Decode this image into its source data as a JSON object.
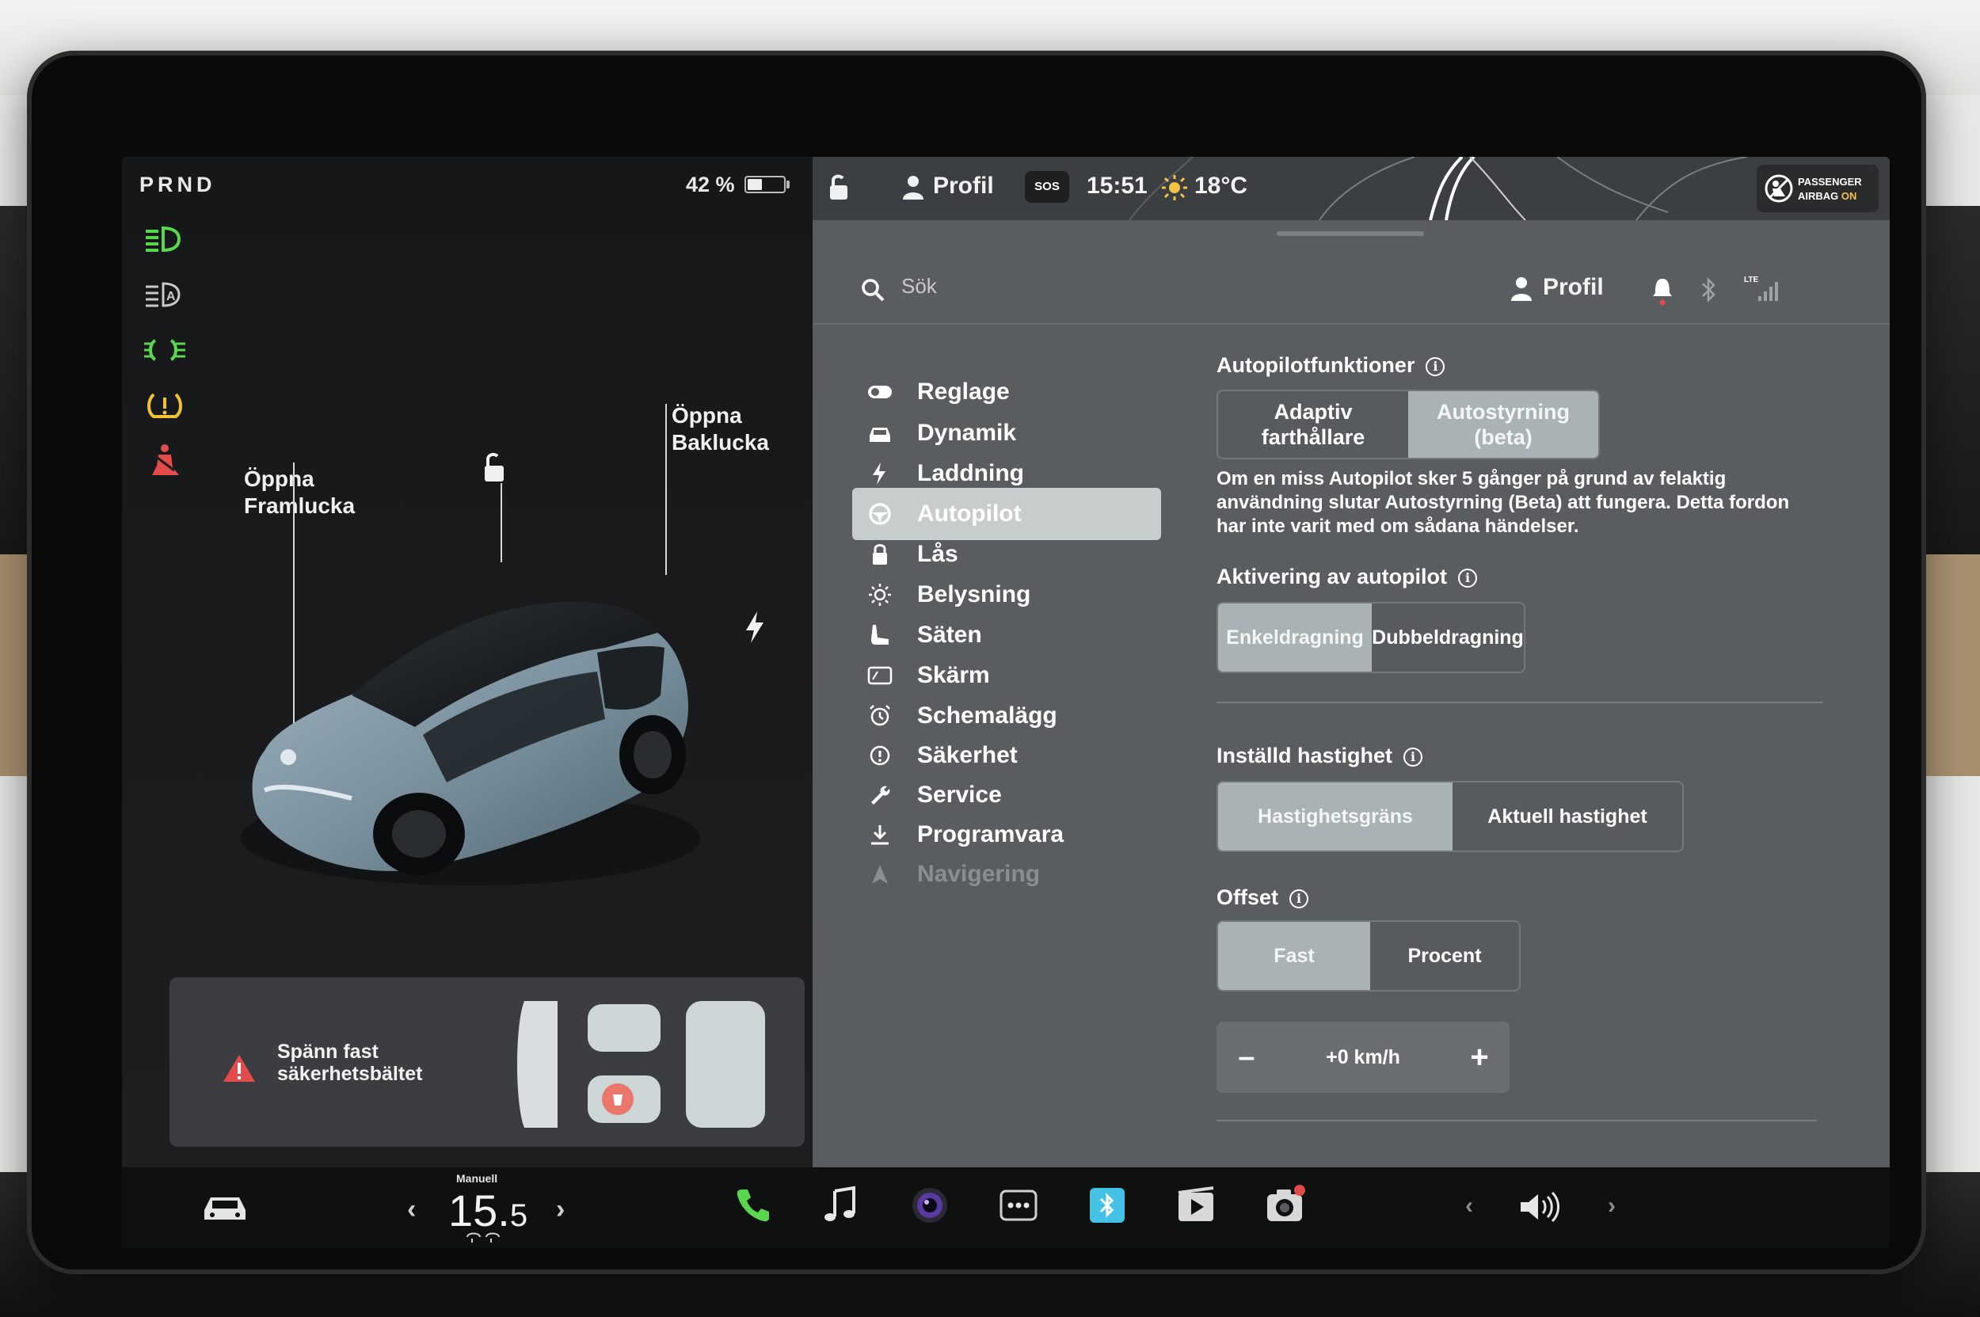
{
  "status": {
    "gear": "PRND",
    "battery_percent": "42 %",
    "battery_level": 0.42,
    "profile": "Profil",
    "sos": "SOS",
    "time": "15:51",
    "temperature": "18°C",
    "airbag_line1": "PASSENGER",
    "airbag_line2_a": "AIRBAG ",
    "airbag_line2_b": "ON"
  },
  "telltales": [
    "headlights-icon",
    "auto-high-beam-icon",
    "parking-lights-icon",
    "tire-pressure-icon",
    "seatbelt-warning-icon"
  ],
  "car": {
    "frunk_label_1": "Öppna",
    "frunk_label_2": "Framlucka",
    "trunk_label_1": "Öppna",
    "trunk_label_2": "Baklucka",
    "seatbelt_alert_1": "Spänn fast",
    "seatbelt_alert_2": "säkerhetsbältet"
  },
  "header": {
    "search_placeholder": "Sök",
    "profile": "Profil"
  },
  "nav": {
    "items": [
      {
        "label": "Reglage",
        "icon": "toggle-icon"
      },
      {
        "label": "Dynamik",
        "icon": "car-icon"
      },
      {
        "label": "Laddning",
        "icon": "lightning-icon"
      },
      {
        "label": "Autopilot",
        "icon": "steering-wheel-icon"
      },
      {
        "label": "Lås",
        "icon": "lock-icon"
      },
      {
        "label": "Belysning",
        "icon": "sun-icon"
      },
      {
        "label": "Säten",
        "icon": "seat-icon"
      },
      {
        "label": "Skärm",
        "icon": "display-icon"
      },
      {
        "label": "Schemalägg",
        "icon": "alarm-clock-icon"
      },
      {
        "label": "Säkerhet",
        "icon": "alert-circle-icon"
      },
      {
        "label": "Service",
        "icon": "wrench-icon"
      },
      {
        "label": "Programvara",
        "icon": "download-icon"
      },
      {
        "label": "Navigering",
        "icon": "navigation-arrow-icon"
      }
    ],
    "active": "Autopilot"
  },
  "autopilot": {
    "features_title": "Autopilotfunktioner",
    "features_opt1_a": "Adaptiv",
    "features_opt1_b": "farthållare",
    "features_opt2_a": "Autostyrning",
    "features_opt2_b": "(beta)",
    "features_selected": "Autostyrning (beta)",
    "warning_1": "Om en miss Autopilot sker 5 gånger på grund av felaktig",
    "warning_2": "användning slutar Autostyrning (Beta) att fungera. Detta fordon",
    "warning_3": "har inte varit med om sådana händelser.",
    "activation_title": "Aktivering av autopilot",
    "activation_opt1": "Enkeldragning",
    "activation_opt2": "Dubbeldragning",
    "activation_selected": "Enkeldragning",
    "speed_title": "Inställd hastighet",
    "speed_opt1": "Hastighetsgräns",
    "speed_opt2": "Aktuell hastighet",
    "speed_selected": "Hastighetsgräns",
    "offset_title": "Offset",
    "offset_opt1": "Fast",
    "offset_opt2": "Procent",
    "offset_selected": "Fast",
    "offset_value": "+0 km/h",
    "minus": "–",
    "plus": "+"
  },
  "taskbar": {
    "climate_mode": "Manuell",
    "temp_whole": "15.",
    "temp_decimal": "5",
    "prev": "‹",
    "next": "›",
    "apps": [
      "phone-icon",
      "music-note-icon",
      "camera-app-icon",
      "more-dots-icon",
      "bluetooth-app-icon",
      "theater-icon",
      "dashcam-icon"
    ],
    "volume_prev": "‹",
    "volume_next": "›"
  },
  "colors": {
    "accent_green": "#59d84f",
    "warning_red": "#e24b4b",
    "warning_yellow": "#f2c230",
    "selected_segment": "#a9b3b5",
    "active_nav": "#c7cccd"
  }
}
